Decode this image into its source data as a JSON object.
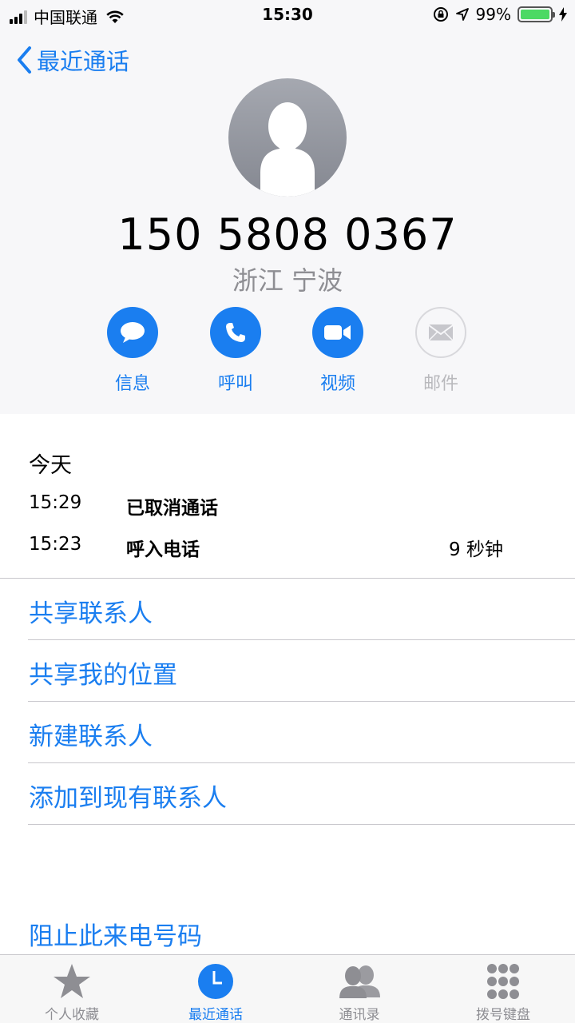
{
  "status": {
    "carrier": "中国联通",
    "time": "15:30",
    "battery": "99%",
    "battery_level": 0.99
  },
  "nav": {
    "back_label": "最近通话"
  },
  "contact": {
    "number": "150 5808 0367",
    "location": "浙江 宁波"
  },
  "actions": [
    {
      "label": "信息",
      "icon": "message-icon",
      "enabled": true
    },
    {
      "label": "呼叫",
      "icon": "phone-icon",
      "enabled": true
    },
    {
      "label": "视频",
      "icon": "video-icon",
      "enabled": true
    },
    {
      "label": "邮件",
      "icon": "mail-icon",
      "enabled": false
    }
  ],
  "history": {
    "heading": "今天",
    "calls": [
      {
        "time": "15:29",
        "type": "已取消通话",
        "duration": ""
      },
      {
        "time": "15:23",
        "type": "呼入电话",
        "duration": "9 秒钟"
      }
    ]
  },
  "options": [
    "共享联系人",
    "共享我的位置",
    "新建联系人",
    "添加到现有联系人"
  ],
  "block": "阻止此来电号码",
  "tabs": [
    {
      "label": "个人收藏",
      "icon": "star-icon",
      "active": false
    },
    {
      "label": "最近通话",
      "icon": "clock-icon",
      "active": true
    },
    {
      "label": "通讯录",
      "icon": "contacts-icon",
      "active": false
    },
    {
      "label": "拨号键盘",
      "icon": "keypad-icon",
      "active": false
    }
  ],
  "colors": {
    "accent": "#1a7ef0",
    "disabled": "#b9b9bd",
    "battery": "#4cd964"
  }
}
